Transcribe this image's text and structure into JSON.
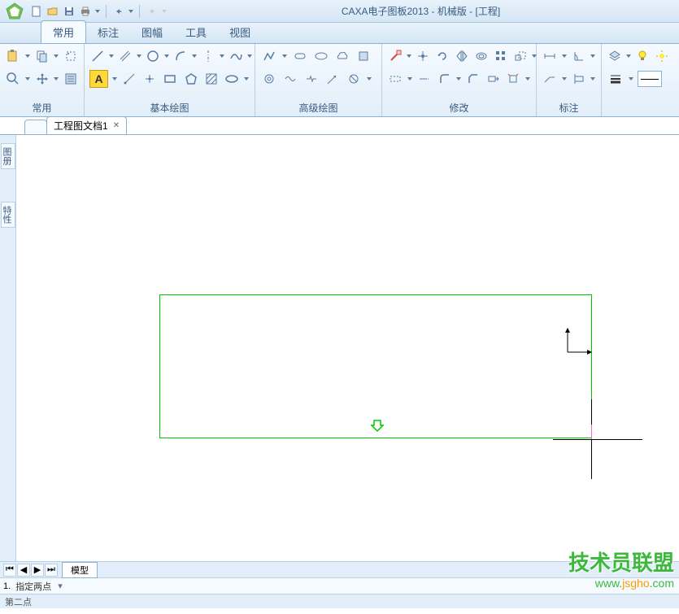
{
  "app": {
    "title": "CAXA电子图板2013 - 机械版 - [工程]"
  },
  "menu": {
    "tabs": [
      "常用",
      "标注",
      "图幅",
      "工具",
      "视图"
    ],
    "active": 0
  },
  "ribbon": {
    "groups": [
      {
        "label": "常用"
      },
      {
        "label": "基本绘图"
      },
      {
        "label": "高级绘图"
      },
      {
        "label": "修改"
      },
      {
        "label": "标注"
      },
      {
        "label": ""
      }
    ]
  },
  "doc": {
    "tab": "工程图文档1"
  },
  "side": {
    "panel1": "图册",
    "panel2": "特性"
  },
  "bottom": {
    "model": "模型"
  },
  "cmd": {
    "num": "1.",
    "prompt": "指定两点"
  },
  "status": {
    "text": "第二点"
  },
  "watermark": {
    "line1": "技术员联盟",
    "line2_a": "www.",
    "line2_b": "jsgho",
    "line2_c": ".com"
  },
  "icons": {
    "a_letter": "A"
  }
}
